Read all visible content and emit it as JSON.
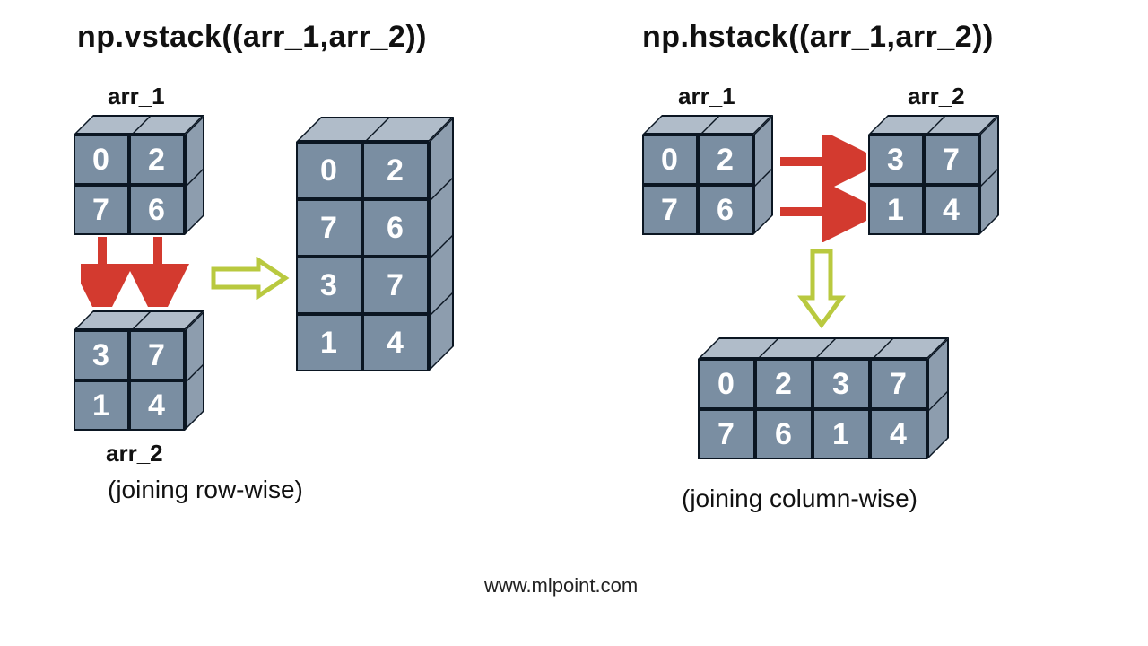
{
  "vstack": {
    "title": "np.vstack((arr_1,arr_2))",
    "label1": "arr_1",
    "label2": "arr_2",
    "caption": "(joining row-wise)",
    "arr1": [
      [
        "0",
        "2"
      ],
      [
        "7",
        "6"
      ]
    ],
    "arr2": [
      [
        "3",
        "7"
      ],
      [
        "1",
        "4"
      ]
    ],
    "result": [
      [
        "0",
        "2"
      ],
      [
        "7",
        "6"
      ],
      [
        "3",
        "7"
      ],
      [
        "1",
        "4"
      ]
    ]
  },
  "hstack": {
    "title": "np.hstack((arr_1,arr_2))",
    "label1": "arr_1",
    "label2": "arr_2",
    "caption": "(joining column-wise)",
    "arr1": [
      [
        "0",
        "2"
      ],
      [
        "7",
        "6"
      ]
    ],
    "arr2": [
      [
        "3",
        "7"
      ],
      [
        "1",
        "4"
      ]
    ],
    "result": [
      [
        "0",
        "2",
        "3",
        "7"
      ],
      [
        "7",
        "6",
        "1",
        "4"
      ]
    ]
  },
  "colors": {
    "face_front": "#7a8ea2",
    "face_top": "#b0bcc9",
    "face_side": "#8d9dae",
    "arrow_red": "#d33a2f",
    "arrow_yellow": "#b9c93f"
  },
  "footer": "www.mlpoint.com"
}
